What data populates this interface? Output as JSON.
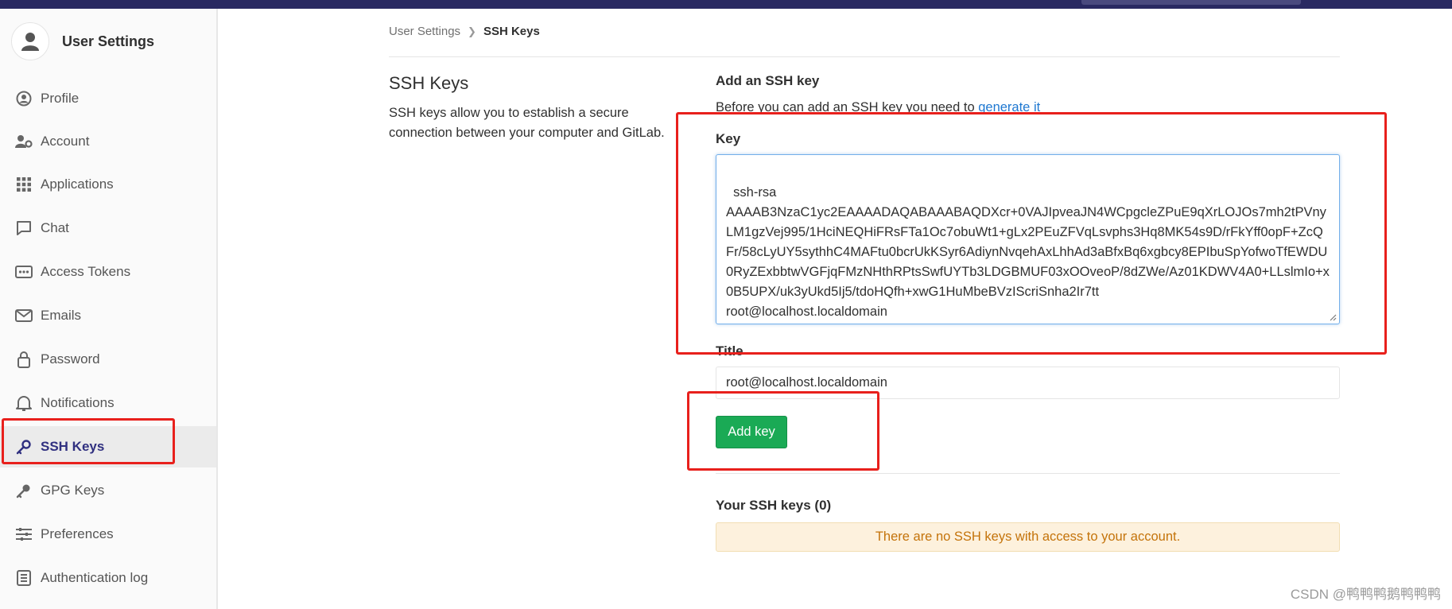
{
  "sidebar": {
    "title": "User Settings",
    "items": [
      {
        "label": "Profile",
        "icon": "profile-icon"
      },
      {
        "label": "Account",
        "icon": "account-icon"
      },
      {
        "label": "Applications",
        "icon": "applications-icon"
      },
      {
        "label": "Chat",
        "icon": "chat-icon"
      },
      {
        "label": "Access Tokens",
        "icon": "access-tokens-icon"
      },
      {
        "label": "Emails",
        "icon": "emails-icon"
      },
      {
        "label": "Password",
        "icon": "lock-icon"
      },
      {
        "label": "Notifications",
        "icon": "bell-icon"
      },
      {
        "label": "SSH Keys",
        "icon": "key-icon"
      },
      {
        "label": "GPG Keys",
        "icon": "key-icon"
      },
      {
        "label": "Preferences",
        "icon": "preferences-icon"
      },
      {
        "label": "Authentication log",
        "icon": "log-icon"
      }
    ]
  },
  "breadcrumb": {
    "parent": "User Settings",
    "current": "SSH Keys"
  },
  "section": {
    "title": "SSH Keys",
    "description": "SSH keys allow you to establish a secure connection between your computer and GitLab."
  },
  "form": {
    "heading": "Add an SSH key",
    "before_text": "Before you can add an SSH key you need to ",
    "generate_link": "generate it",
    "key_label": "Key",
    "key_value": "ssh-rsa\nAAAAB3NzaC1yc2EAAAADAQABAAABAQDXcr+0VAJIpveaJN4WCpgcleZPuE9qXrLOJOs7mh2tPVnyLM1gzVej995/1HciNEQHiFRsFTa1Oc7obuWt1+gLx2PEuZFVqLsvphs3Hq8MK54s9D/rFkYff0opF+ZcQFr/58cLyUY5sythhC4MAFtu0bcrUkKSyr6AdiynNvqehAxLhhAd3aBfxBq6xgbcy8EPIbuSpYofwoTfEWDU0RyZExbbtwVGFjqFMzNHthRPtsSwfUYTb3LDGBMUF03xOOveoP/8dZWe/Az01KDWV4A0+LLslmIo+x0B5UPX/uk3yUkd5Ij5/tdoHQfh+xwG1HuMbeBVzIScriSnha2Ir7tt\nroot@localhost.localdomain",
    "title_label": "Title",
    "title_value": "root@localhost.localdomain",
    "submit_label": "Add key"
  },
  "your_keys": {
    "heading": "Your SSH keys (0)",
    "empty_message": "There are no SSH keys with access to your account."
  },
  "watermark": "CSDN @鸭鸭鸭鹅鸭鸭鸭",
  "colors": {
    "topbar": "#292961",
    "accent_link": "#1f78d1",
    "button_green": "#1aaa55",
    "highlight_red": "#e8201c",
    "warning_bg": "#fdf1dd"
  }
}
